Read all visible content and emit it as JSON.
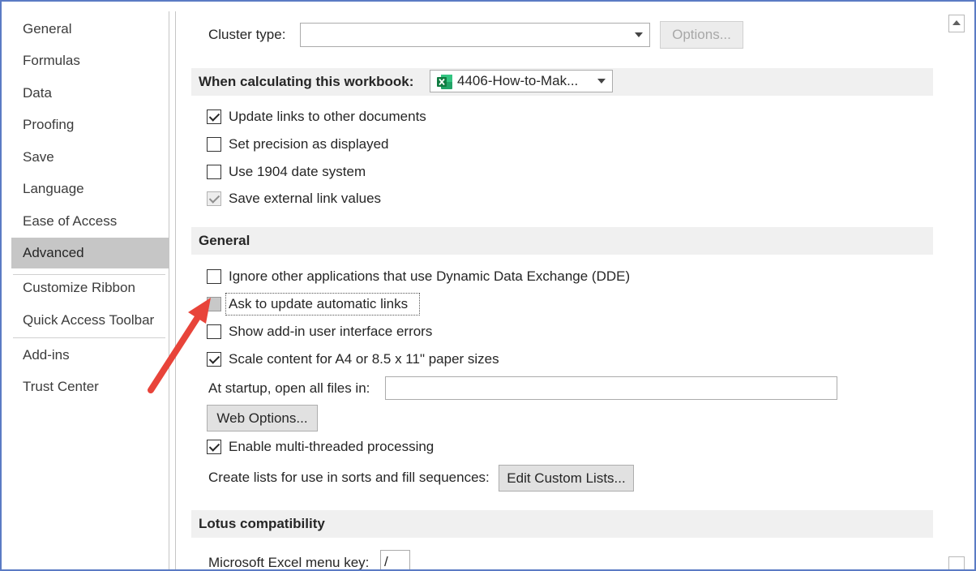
{
  "sidebar": {
    "items": [
      {
        "label": "General"
      },
      {
        "label": "Formulas"
      },
      {
        "label": "Data"
      },
      {
        "label": "Proofing"
      },
      {
        "label": "Save"
      },
      {
        "label": "Language"
      },
      {
        "label": "Ease of Access"
      },
      {
        "label": "Advanced",
        "selected": true
      },
      {
        "label": "Customize Ribbon"
      },
      {
        "label": "Quick Access Toolbar"
      },
      {
        "label": "Add-ins"
      },
      {
        "label": "Trust Center"
      }
    ]
  },
  "cluster": {
    "label": "Cluster type:",
    "value": "",
    "options_button": "Options..."
  },
  "calc_section": {
    "title": "When calculating this workbook:",
    "workbook": "4406-How-to-Mak...",
    "workbook_icon": "excel-file-icon",
    "checks": [
      {
        "label": "Update links to other documents",
        "checked": true,
        "enabled": true
      },
      {
        "label": "Set precision as displayed",
        "checked": false,
        "enabled": true
      },
      {
        "label": "Use 1904 date system",
        "checked": false,
        "enabled": true
      },
      {
        "label": "Save external link values",
        "checked": true,
        "enabled": false
      }
    ]
  },
  "general_section": {
    "title": "General",
    "checks": [
      {
        "label": "Ignore other applications that use Dynamic Data Exchange (DDE)",
        "checked": false
      },
      {
        "label": "Ask to update automatic links",
        "checked": false
      },
      {
        "label": "Show add-in user interface errors",
        "checked": false
      },
      {
        "label": "Scale content for A4 or 8.5 x 11\" paper sizes",
        "checked": true
      }
    ],
    "startup_label": "At startup, open all files in:",
    "startup_value": "",
    "web_options_button": "Web Options...",
    "multithread": {
      "label": "Enable multi-threaded processing",
      "checked": true
    },
    "custom_lists_label": "Create lists for use in sorts and fill sequences:",
    "custom_lists_button": "Edit Custom Lists..."
  },
  "lotus_section": {
    "title": "Lotus compatibility",
    "menu_key_label": "Microsoft Excel menu key:",
    "menu_key_value": "/"
  },
  "annotation": {
    "color": "#e8443a",
    "icon": "red-arrow-icon"
  }
}
